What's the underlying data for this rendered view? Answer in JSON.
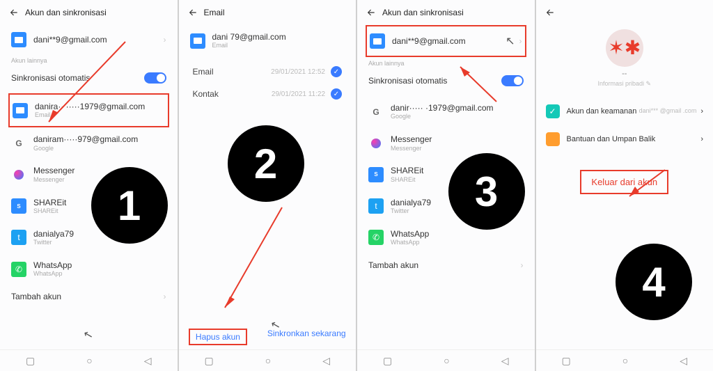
{
  "step_labels": [
    "1",
    "2",
    "3",
    "4"
  ],
  "nav_icons": {
    "square": "▢",
    "circle": "○",
    "tri": "◁"
  },
  "chevron": "›",
  "check": "✓",
  "panel1": {
    "title": "Akun dan sinkronisasi",
    "primary_email": "dani**9@gmail.com",
    "other_label": "Akun lainnya",
    "auto_sync": "Sinkronisasi otomatis",
    "accounts": [
      {
        "id": "email",
        "name": "danira··  ·····1979@gmail.com",
        "sub": "Email",
        "iconClass": "mail-icon"
      },
      {
        "id": "google",
        "name": "daniram·····979@gmail.com",
        "sub": "Google",
        "iconClass": "google-icon"
      },
      {
        "id": "messenger",
        "name": "Messenger",
        "sub": "Messenger",
        "iconClass": "msg-icon"
      },
      {
        "id": "shareit",
        "name": "SHAREit",
        "sub": "SHAREit",
        "iconClass": "share-icon",
        "iconText": "S"
      },
      {
        "id": "twitter",
        "name": "danialya79",
        "sub": "Twitter",
        "iconClass": "twitter-icon",
        "iconText": "t"
      },
      {
        "id": "whatsapp",
        "name": "WhatsApp",
        "sub": "WhatsApp",
        "iconClass": "wa-icon",
        "iconText": "✆"
      }
    ],
    "add": "Tambah akun"
  },
  "panel2": {
    "title": "Email",
    "account": "dani            79@gmail.com",
    "account_sub": "Email",
    "syncs": [
      {
        "label": "Email",
        "date": "29/01/2021 12:52"
      },
      {
        "label": "Kontak",
        "date": "29/01/2021 11:22"
      }
    ],
    "actions": {
      "delete": "Hapus akun",
      "syncnow": "Sinkronkan sekarang"
    }
  },
  "panel3": {
    "title": "Akun dan sinkronisasi",
    "primary_email": "dani**9@gmail.com",
    "other_label": "Akun lainnya",
    "auto_sync": "Sinkronisasi otomatis",
    "accounts": [
      {
        "id": "google",
        "name": "danir·····  ·1979@gmail.com",
        "sub": "Google",
        "iconClass": "google-icon"
      },
      {
        "id": "messenger",
        "name": "Messenger",
        "sub": "Messenger",
        "iconClass": "msg-icon"
      },
      {
        "id": "shareit",
        "name": "SHAREit",
        "sub": "SHAREit",
        "iconClass": "share-icon",
        "iconText": "S"
      },
      {
        "id": "twitter",
        "name": "danialya79",
        "sub": "Twitter",
        "iconClass": "twitter-icon",
        "iconText": "t"
      },
      {
        "id": "whatsapp",
        "name": "WhatsApp",
        "sub": "WhatsApp",
        "iconClass": "wa-icon",
        "iconText": "✆"
      }
    ],
    "add": "Tambah akun"
  },
  "panel4": {
    "name_placeholder": "--",
    "info": "Informasi pribadi",
    "email_masked": "dani*** @gmail .com",
    "items": [
      {
        "id": "security",
        "label": "Akun dan keamanan",
        "iconClass": "shield-icon",
        "iconText": "✓"
      },
      {
        "id": "help",
        "label": "Bantuan dan Umpan Balik",
        "iconClass": "dot-icon",
        "iconText": ""
      }
    ],
    "signout": "Keluar dari akun"
  }
}
